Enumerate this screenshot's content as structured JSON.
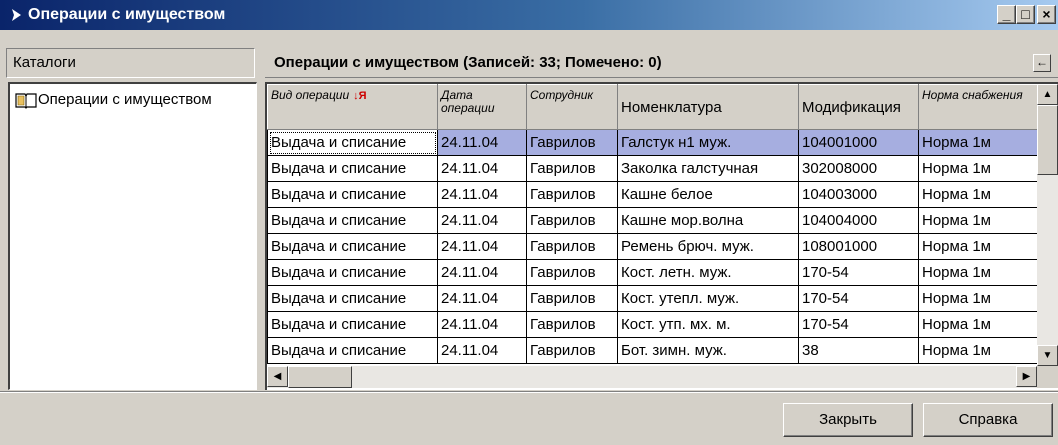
{
  "window": {
    "title": "Операции с имуществом",
    "minimize": "_",
    "maximize": "□",
    "close": "×"
  },
  "left": {
    "header": "Каталоги",
    "tree": [
      {
        "label": "Операции с имуществом",
        "icon": "book-icon"
      }
    ]
  },
  "grid": {
    "caption": "Операции с имуществом (Записей: 33; Помечено: 0)",
    "columns": [
      {
        "label": "Вид операции",
        "style": "italic",
        "sorted": true
      },
      {
        "label": "Дата операции",
        "style": "italic"
      },
      {
        "label": "Сотрудник",
        "style": "italic"
      },
      {
        "label": "Номенклатура",
        "style": "normal"
      },
      {
        "label": "Модификация",
        "style": "normal"
      },
      {
        "label": "Норма снабжения",
        "style": "italic"
      }
    ],
    "sort_icon_text": "↓Я",
    "rows": [
      [
        "Выдача и списание",
        "24.11.04",
        "Гаврилов",
        "Галстук н1 муж.",
        "104001000",
        "Норма 1м"
      ],
      [
        "Выдача и списание",
        "24.11.04",
        "Гаврилов",
        "Заколка галстучная",
        "302008000",
        "Норма 1м"
      ],
      [
        "Выдача и списание",
        "24.11.04",
        "Гаврилов",
        "Кашне белое",
        "104003000",
        "Норма 1м"
      ],
      [
        "Выдача и списание",
        "24.11.04",
        "Гаврилов",
        "Кашне мор.волна",
        "104004000",
        "Норма 1м"
      ],
      [
        "Выдача и списание",
        "24.11.04",
        "Гаврилов",
        "Ремень брюч. муж.",
        "108001000",
        "Норма 1м"
      ],
      [
        "Выдача и списание",
        "24.11.04",
        "Гаврилов",
        "Кост. летн. муж.",
        "170-54",
        "Норма 1м"
      ],
      [
        "Выдача и списание",
        "24.11.04",
        "Гаврилов",
        "Кост. утепл. муж.",
        "170-54",
        "Норма 1м"
      ],
      [
        "Выдача и списание",
        "24.11.04",
        "Гаврилов",
        "Кост. утп. мх. м.",
        "170-54",
        "Норма 1м"
      ],
      [
        "Выдача и списание",
        "24.11.04",
        "Гаврилов",
        "Бот. зимн. муж.",
        "38",
        "Норма 1м"
      ]
    ],
    "selected_row": 0
  },
  "buttons": {
    "close_label": "Закрыть",
    "help_label": "Справка",
    "collapse": "←"
  },
  "colors": {
    "title_start": "#0a246a",
    "title_end": "#a6caf0",
    "selection": "#a6aee0",
    "face": "#d4d0c8"
  }
}
